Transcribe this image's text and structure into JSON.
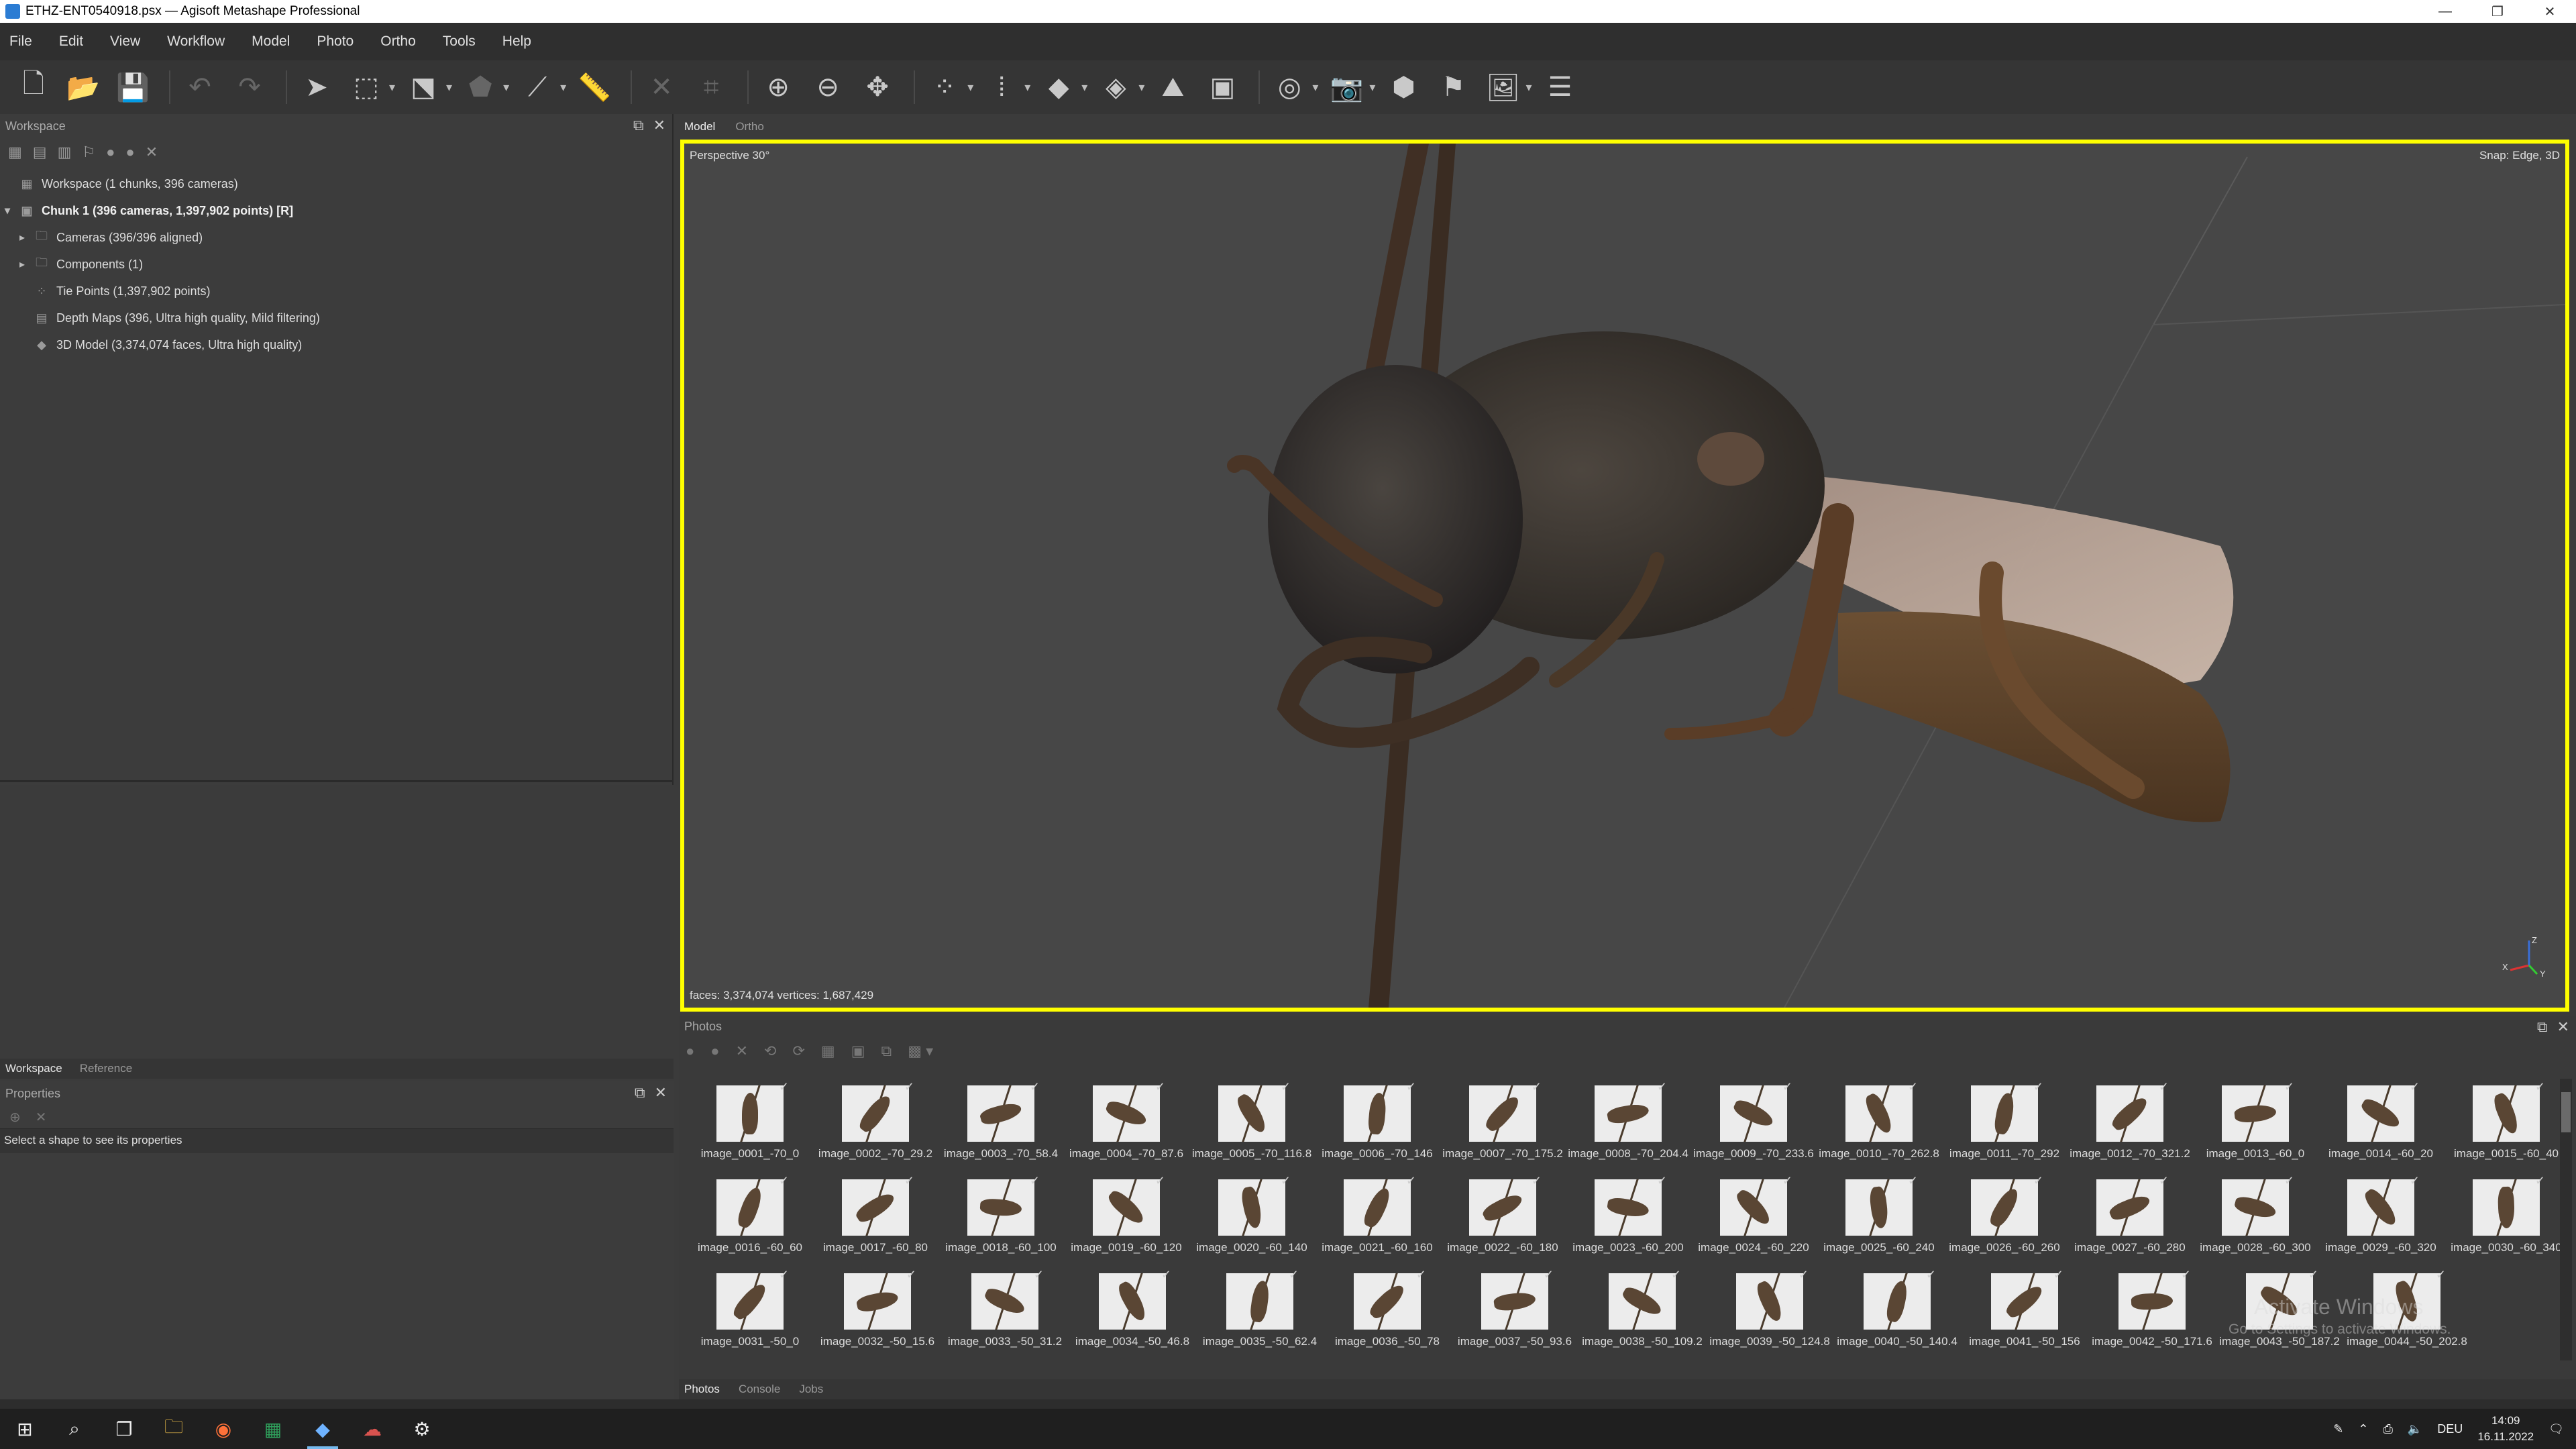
{
  "window": {
    "title": "ETHZ-ENT0540918.psx — Agisoft Metashape Professional",
    "controls": [
      "—",
      "❐",
      "✕"
    ]
  },
  "menu": [
    "File",
    "Edit",
    "View",
    "Workflow",
    "Model",
    "Photo",
    "Ortho",
    "Tools",
    "Help"
  ],
  "workspace": {
    "header": "Workspace",
    "tree": [
      {
        "label": "Workspace (1 chunks, 396 cameras)",
        "icon": "workspace-icon",
        "level": 0,
        "expander": ""
      },
      {
        "label": "Chunk 1 (396 cameras, 1,397,902 points) [R]",
        "icon": "chunk-icon",
        "level": 0,
        "expander": "▾",
        "bold": true
      },
      {
        "label": "Cameras (396/396 aligned)",
        "icon": "folder-icon",
        "level": 1,
        "expander": "▸"
      },
      {
        "label": "Components (1)",
        "icon": "folder-icon",
        "level": 1,
        "expander": "▸"
      },
      {
        "label": "Tie Points (1,397,902 points)",
        "icon": "tie-points-icon",
        "level": 1,
        "expander": ""
      },
      {
        "label": "Depth Maps (396, Ultra high quality, Mild filtering)",
        "icon": "depth-maps-icon",
        "level": 1,
        "expander": ""
      },
      {
        "label": "3D Model (3,374,074 faces, Ultra high quality)",
        "icon": "model-icon",
        "level": 1,
        "expander": ""
      }
    ],
    "tabs": [
      "Workspace",
      "Reference"
    ]
  },
  "properties": {
    "header": "Properties",
    "hint": "Select a shape to see its properties"
  },
  "viewport": {
    "tabs": [
      "Model",
      "Ortho"
    ],
    "projection": "Perspective 30°",
    "snap": "Snap: Edge, 3D",
    "stats": "faces: 3,374,074 vertices: 1,687,429",
    "highlight_color": "#ffff00",
    "axes": {
      "x": "X",
      "y": "Y",
      "z": "Z"
    }
  },
  "photos": {
    "header": "Photos",
    "rows": [
      [
        "image_0001_-70_0",
        "image_0002_-70_29.2",
        "image_0003_-70_58.4",
        "image_0004_-70_87.6",
        "image_0005_-70_116.8",
        "image_0006_-70_146",
        "image_0007_-70_175.2",
        "image_0008_-70_204.4",
        "image_0009_-70_233.6",
        "image_0010_-70_262.8",
        "image_0011_-70_292",
        "image_0012_-70_321.2",
        "image_0013_-60_0",
        "image_0014_-60_20",
        "image_0015_-60_40"
      ],
      [
        "image_0016_-60_60",
        "image_0017_-60_80",
        "image_0018_-60_100",
        "image_0019_-60_120",
        "image_0020_-60_140",
        "image_0021_-60_160",
        "image_0022_-60_180",
        "image_0023_-60_200",
        "image_0024_-60_220",
        "image_0025_-60_240",
        "image_0026_-60_260",
        "image_0027_-60_280",
        "image_0028_-60_300",
        "image_0029_-60_320",
        "image_0030_-60_340"
      ],
      [
        "image_0031_-50_0",
        "image_0032_-50_15.6",
        "image_0033_-50_31.2",
        "image_0034_-50_46.8",
        "image_0035_-50_62.4",
        "image_0036_-50_78",
        "image_0037_-50_93.6",
        "image_0038_-50_109.2",
        "image_0039_-50_124.8",
        "image_0040_-50_140.4",
        "image_0041_-50_156",
        "image_0042_-50_171.6",
        "image_0043_-50_187.2",
        "image_0044_-50_202.8"
      ]
    ],
    "tabs": [
      "Photos",
      "Console",
      "Jobs"
    ]
  },
  "watermark": {
    "line1": "Activate Windows",
    "line2": "Go to Settings to activate Windows."
  },
  "taskbar": {
    "clock_time": "14:09",
    "clock_date": "16.11.2022",
    "language": "DEU"
  }
}
